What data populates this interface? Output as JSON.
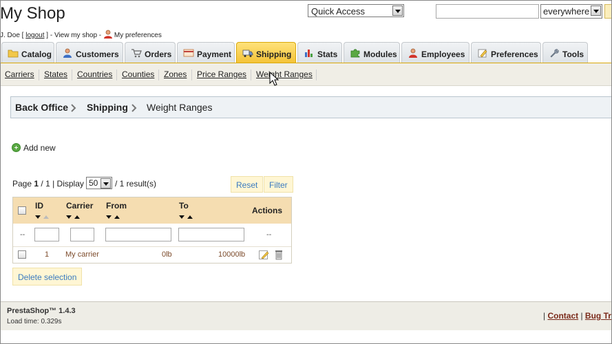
{
  "header": {
    "shop_name": "My Shop",
    "user_name": "J. Doe",
    "logout": "logout",
    "view_my_shop": "View my shop",
    "my_preferences": "My preferences",
    "quick_access": "Quick Access",
    "search_value": "",
    "search_scope": "everywhere"
  },
  "tabs": [
    {
      "label": "Catalog",
      "icon": "folder-icon"
    },
    {
      "label": "Customers",
      "icon": "customer-icon"
    },
    {
      "label": "Orders",
      "icon": "cart-icon"
    },
    {
      "label": "Payment",
      "icon": "payment-icon"
    },
    {
      "label": "Shipping",
      "icon": "truck-icon",
      "active": true
    },
    {
      "label": "Stats",
      "icon": "stats-icon"
    },
    {
      "label": "Modules",
      "icon": "puzzle-icon"
    },
    {
      "label": "Employees",
      "icon": "employee-icon"
    },
    {
      "label": "Preferences",
      "icon": "preferences-icon"
    },
    {
      "label": "Tools",
      "icon": "wrench-icon"
    }
  ],
  "subtabs": [
    "Carriers",
    "States",
    "Countries",
    "Counties",
    "Zones",
    "Price Ranges",
    "Weight Ranges"
  ],
  "breadcrumb": [
    "Back Office",
    "Shipping",
    "Weight Ranges"
  ],
  "add_new": "Add new",
  "pagination": {
    "page_label": "Page",
    "current": "1",
    "total": "/ 1",
    "display_label": "| Display",
    "per_page": "50",
    "results": "/ 1 result(s)"
  },
  "buttons": {
    "reset": "Reset",
    "filter": "Filter",
    "delete_selection": "Delete selection"
  },
  "table": {
    "headers": {
      "id": "ID",
      "carrier": "Carrier",
      "from": "From",
      "to": "To",
      "actions": "Actions"
    },
    "filter_placeholder": "--",
    "actions_placeholder": "--",
    "rows": [
      {
        "id": "1",
        "carrier": "My carrier",
        "from": "0lb",
        "to": "10000lb"
      }
    ]
  },
  "footer": {
    "version": "PrestaShop™ 1.4.3",
    "load_time": "Load time: 0.329s",
    "contact": "Contact",
    "bug_tracker": "Bug Trac"
  },
  "colors": {
    "active_tab": "#f4c338",
    "table_header": "#f5ddb1",
    "link_blue": "#3a7bc0",
    "data_brown": "#7c4a2a"
  }
}
